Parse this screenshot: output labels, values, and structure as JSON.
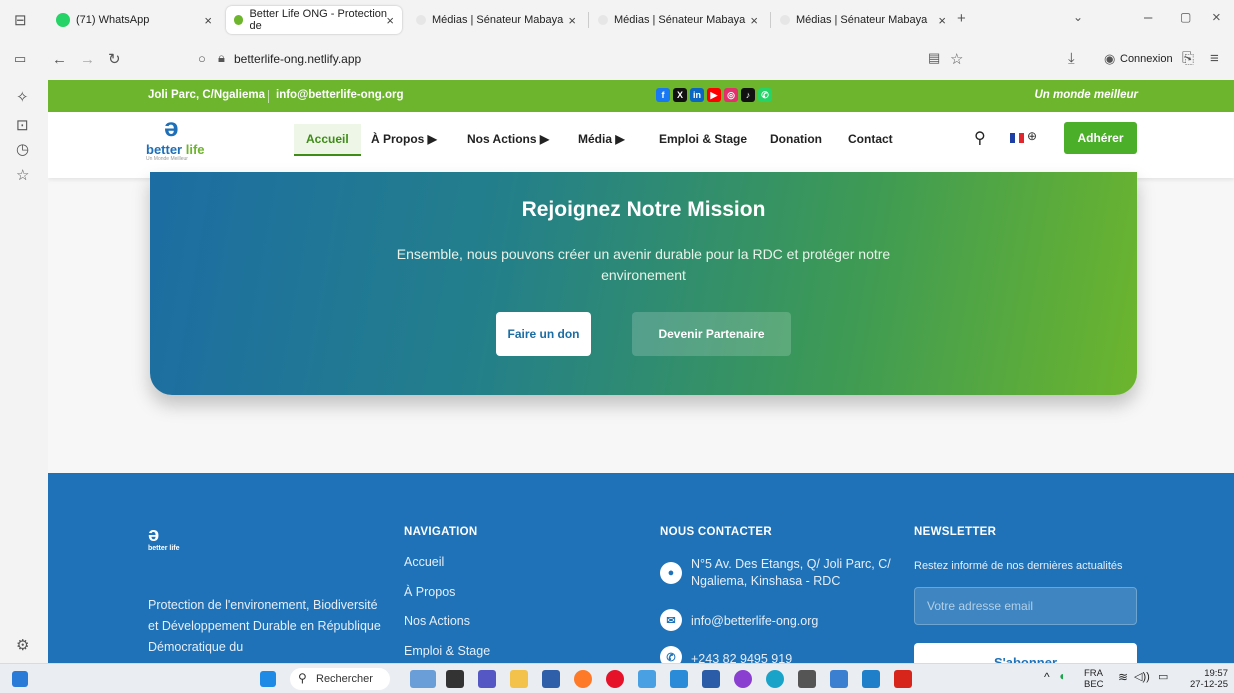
{
  "browser": {
    "tabs": [
      {
        "label": "(71) WhatsApp",
        "fav_color": "#25d366",
        "fav_text": "71"
      },
      {
        "label": "Better Life ONG - Protection de",
        "fav_color": "#6cb52d",
        "active": true
      },
      {
        "label": "Médias | Sénateur Mabaya",
        "fav_color": "#e6e6e6"
      },
      {
        "label": "Médias | Sénateur Mabaya",
        "fav_color": "#e6e6e6"
      },
      {
        "label": "Médias | Sénateur Mabaya",
        "fav_color": "#e6e6e6"
      }
    ],
    "url": "betterlife-ong.netlify.app",
    "connexion_label": "Connexion"
  },
  "topbar": {
    "address": "Joli Parc, C/Ngaliema",
    "email": "info@betterlife-ong.org",
    "slogan": "Un monde meilleur",
    "social": [
      {
        "name": "facebook-icon",
        "color": "#1877f2",
        "glyph": "f"
      },
      {
        "name": "x-icon",
        "color": "#111111",
        "glyph": "X"
      },
      {
        "name": "linkedin-icon",
        "color": "#0a66c2",
        "glyph": "in"
      },
      {
        "name": "youtube-icon",
        "color": "#ff0000",
        "glyph": "▶"
      },
      {
        "name": "instagram-icon",
        "color": "#e1306c",
        "glyph": "◎"
      },
      {
        "name": "tiktok-icon",
        "color": "#111111",
        "glyph": "♪"
      },
      {
        "name": "whatsapp-icon",
        "color": "#25d366",
        "glyph": "✆"
      }
    ]
  },
  "header": {
    "logo_text_a": "better",
    "logo_text_b": " life",
    "logo_tag": "Un Monde Meilleur",
    "menu": {
      "home": "Accueil",
      "about": "À Propos ▶",
      "actions": "Nos Actions ▶",
      "media": "Média ▶",
      "jobs": "Emploi & Stage",
      "donation": "Donation",
      "contact": "Contact"
    },
    "join_button": "Adhérer"
  },
  "mission": {
    "title": "Rejoignez Notre Mission",
    "text": "Ensemble, nous pouvons créer un avenir durable pour la RDC et protéger notre environement",
    "donate_button": "Faire un don",
    "partner_button": "Devenir Partenaire"
  },
  "footer": {
    "logo_text": "better life",
    "description": "Protection de l'environement, Biodiversité et Développement Durable en République Démocratique du",
    "nav_title": "NAVIGATION",
    "nav_links": [
      "Accueil",
      "À Propos",
      "Nos Actions",
      "Emploi & Stage"
    ],
    "contact_title": "NOUS CONTACTER",
    "contact_address": "N°5 Av. Des Etangs, Q/ Joli Parc, C/ Ngaliema, Kinshasa - RDC",
    "contact_email": "info@betterlife-ong.org",
    "contact_phone": "+243 82 9495 919",
    "newsletter_title": "NEWSLETTER",
    "newsletter_text": "Restez informé de nos dernières actualités",
    "newsletter_placeholder": "Votre adresse email",
    "newsletter_button": "S'abonner"
  },
  "taskbar": {
    "search_label": "Rechercher",
    "lang_a": "FRA",
    "lang_b": "BEC",
    "time": "19:57",
    "date": "27-12-25"
  }
}
